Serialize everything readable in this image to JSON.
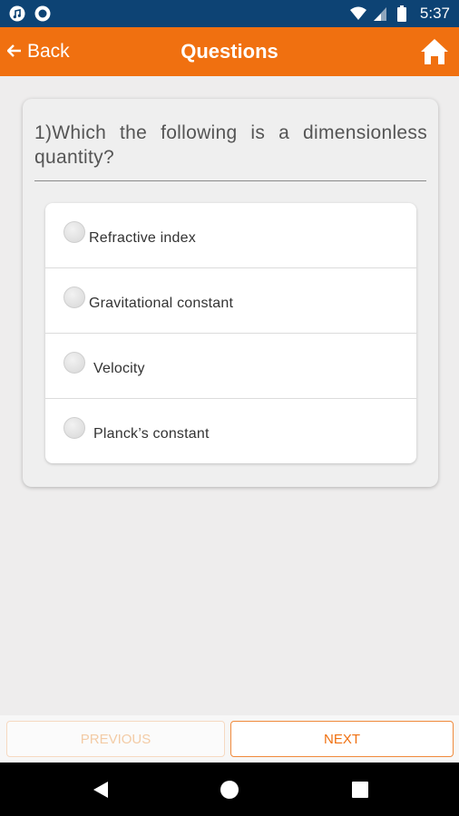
{
  "status_bar": {
    "time": "5:37",
    "left_icons": [
      "music-note-icon",
      "circle-status-icon"
    ],
    "right_icons": [
      "wifi-icon",
      "signal-icon",
      "battery-icon"
    ]
  },
  "app_bar": {
    "back_label": "Back",
    "title": "Questions",
    "home_icon": "home-icon"
  },
  "question": {
    "line1": "1)Which the following is a dimensionless",
    "line2": "quantity?"
  },
  "options": [
    {
      "label": "Refractive index"
    },
    {
      "label": "Gravitational constant"
    },
    {
      "label": "Velocity"
    },
    {
      "label": "Planck’s constant"
    }
  ],
  "buttons": {
    "previous_label": "PREVIOUS",
    "next_label": "NEXT"
  },
  "colors": {
    "accent": "#f07010",
    "status_bar": "#0d4374"
  }
}
